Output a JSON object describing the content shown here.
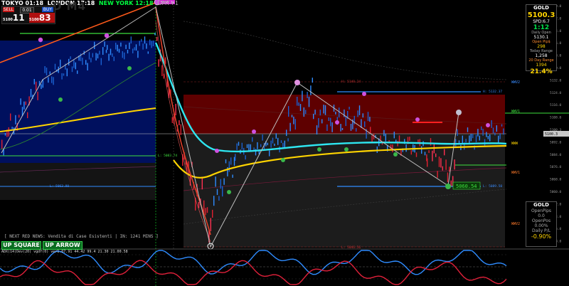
{
  "header": {
    "tokyo": "TOKYO 01:18",
    "london": "LONDON 17:18",
    "newyork": "NEW YORK 12:18",
    "gmt": "GMT+1",
    "watermark": "D M4"
  },
  "trade_panel": {
    "sell_label": "SELL",
    "lot_value": "0.01",
    "buy_label": "BUY",
    "bid_prefix": "5100",
    "bid_big": "11",
    "ask_prefix": "5100",
    "ask_big": "83"
  },
  "info_panel": {
    "symbol": "GOLD",
    "price": "5100.3",
    "spread": "SPD:6.7",
    "timer": "1:12",
    "daily_open_label": "Daily Open",
    "daily_open": "5130.1",
    "open_pips_label": "Open Pip$",
    "open_pips": "298",
    "today_range_label": "Today Range",
    "today_range": "1,258",
    "range20_label": "20 Day Range",
    "range20": "1394",
    "percent": "21.4%"
  },
  "account_panel": {
    "symbol": "GOLD",
    "open_pips_label": "OpenPips",
    "open_pips": "0.0",
    "open_pos_label": "OpenPos",
    "open_pos": "0.00%",
    "daily_pl_label": "Daily P/L",
    "daily_pl": "-0.90%"
  },
  "news": "[ NEXT RED NEWS: Vendita di Case Esistenti | IN: 1241 MINS ]",
  "buttons": {
    "up_square": "UP SQUARE",
    "up_arrow": "UP ARROW"
  },
  "levels": {
    "wwv2_top": "WWV2",
    "wwv1_top": "WWV1",
    "www": "WWW",
    "wwv1_bot": "WWV1",
    "wwv2_bot": "WWV2",
    "h_5132": "H: 5132.37",
    "l_5089": "L: 5089.50",
    "l_5083": "L: 5083.74",
    "l_5063": "L: 5063.80",
    "lvl_5140": "H: 5140.24",
    "lvl_5046": "L: 5046.56",
    "price_tag": "5060.54",
    "top_marker": "5156.79"
  },
  "osc_label": "ADX(14)Dev(20) vgdf(0) ver1.07.91 44.42 99.4  21.30 21.00.58",
  "price_axis": [
    "5180.0",
    "5172.0",
    "5164.0",
    "5156.0",
    "5148.0",
    "5140.0",
    "5132.0",
    "5124.0",
    "5116.0",
    "5108.0",
    "5100.3",
    "5092.0",
    "5084.0",
    "5076.0",
    "5068.0",
    "5060.0",
    "5052.0",
    "5044.0",
    "5036.0",
    "5028.0"
  ],
  "colors": {
    "cyan_ma": "#2ee6f0",
    "yellow_ma": "#ffd400",
    "red_zone": "#6b0000",
    "blue_zone": "#000a6b",
    "gold_text": "#ffd400",
    "green": "#00e04a",
    "pink": "#d050e0"
  }
}
